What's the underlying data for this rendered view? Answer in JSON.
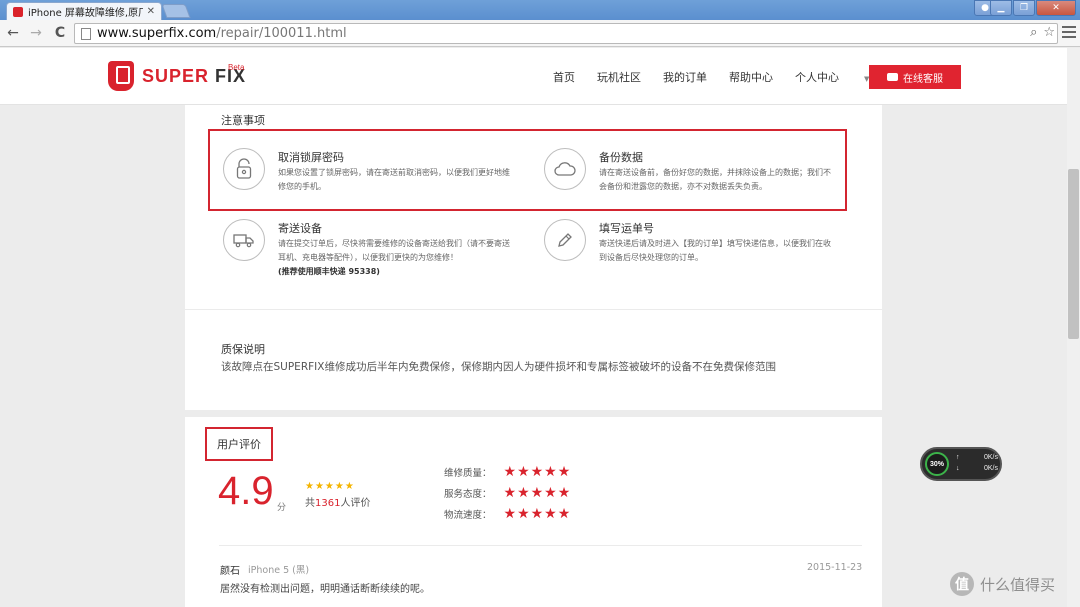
{
  "browser": {
    "tab_title": "iPhone 屏幕故障维修,原厂",
    "tab_close": "✕",
    "url_host": "www.superfix.com",
    "url_path": "/repair/100011.html",
    "back": "←",
    "forward": "→",
    "reload": "C",
    "search_icon": "⌕",
    "star_icon": "☆"
  },
  "site": {
    "logo_super": "SUPER",
    "logo_fix": "FIX",
    "logo_beta": "Beta",
    "nav": [
      "首页",
      "玩机社区",
      "我的订单",
      "帮助中心",
      "个人中心"
    ],
    "nav_caret": "▼",
    "service_button": "在线客服",
    "brand_color": "#d9232d"
  },
  "notes": {
    "title": "注意事项",
    "items": [
      {
        "title": "取消锁屏密码",
        "desc": "如果您设置了锁屏密码，请在寄送前取消密码，以便我们更好地维修您的手机。",
        "icon": "lock-icon"
      },
      {
        "title": "备份数据",
        "desc": "请在寄送设备前，备份好您的数据，并抹除设备上的数据；我们不会备份和泄露您的数据，亦不对数据丢失负责。",
        "icon": "cloud-icon"
      },
      {
        "title": "寄送设备",
        "desc": "请在提交订单后，尽快将需要维修的设备寄送给我们（请不要寄送耳机、充电器等配件），以便我们更快的为您维修！",
        "note": "(推荐使用顺丰快递 95338)",
        "icon": "truck-icon"
      },
      {
        "title": "填写运单号",
        "desc": "寄送快递后请及时进入【我的订单】填写快递信息，以便我们在收到设备后尽快处理您的订单。",
        "icon": "pencil-icon"
      }
    ]
  },
  "warranty": {
    "title": "质保说明",
    "text": "该故障点在SUPERFIX维修成功后半年内免费保修，保修期内因人为硬件损坏和专属标签被破坏的设备不在免费保修范围"
  },
  "reviews": {
    "title": "用户评价",
    "score": "4.9",
    "score_unit": "分",
    "small_stars": "★★★★★",
    "count_prefix": "共",
    "count": "1361",
    "count_suffix": "人评价",
    "ratings": [
      {
        "label": "维修质量：",
        "stars": "★★★★★"
      },
      {
        "label": "服务态度：",
        "stars": "★★★★★"
      },
      {
        "label": "物流速度：",
        "stars": "★★★★★"
      }
    ],
    "entries": [
      {
        "user": "颜石",
        "device": "iPhone 5 (黑)",
        "date": "2015-11-23",
        "text": "居然没有检测出问题，明明通话断断续续的呢。"
      }
    ]
  },
  "net_widget": {
    "percent": "30%",
    "up_arrow": "↑",
    "down_arrow": "↓",
    "up_speed": "0K/s",
    "down_speed": "0K/s"
  },
  "watermark": {
    "badge": "值",
    "text": "什么值得买"
  }
}
